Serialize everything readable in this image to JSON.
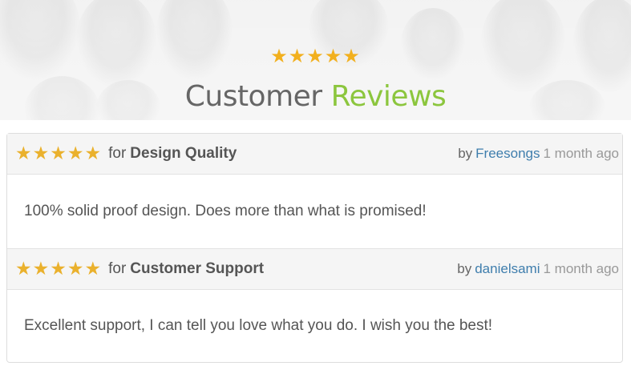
{
  "hero": {
    "stars": "★★★★★",
    "title_plain": "Customer",
    "title_accent": "Reviews"
  },
  "reviews": [
    {
      "stars": "★★★★★",
      "for_label": "for",
      "category": "Design Quality",
      "by_label": "by",
      "author": "Freesongs",
      "time": "1 month ago",
      "text": "100% solid proof design. Does more than what is promised!"
    },
    {
      "stars": "★★★★★",
      "for_label": "for",
      "category": "Customer Support",
      "by_label": "by",
      "author": "danielsami",
      "time": "1 month ago",
      "text": "Excellent support, I can tell you love what you do. I wish you the best!"
    }
  ],
  "colors": {
    "accent_green": "#8cc63e",
    "star_gold": "#eab12d",
    "author_link": "#3f7ead"
  }
}
